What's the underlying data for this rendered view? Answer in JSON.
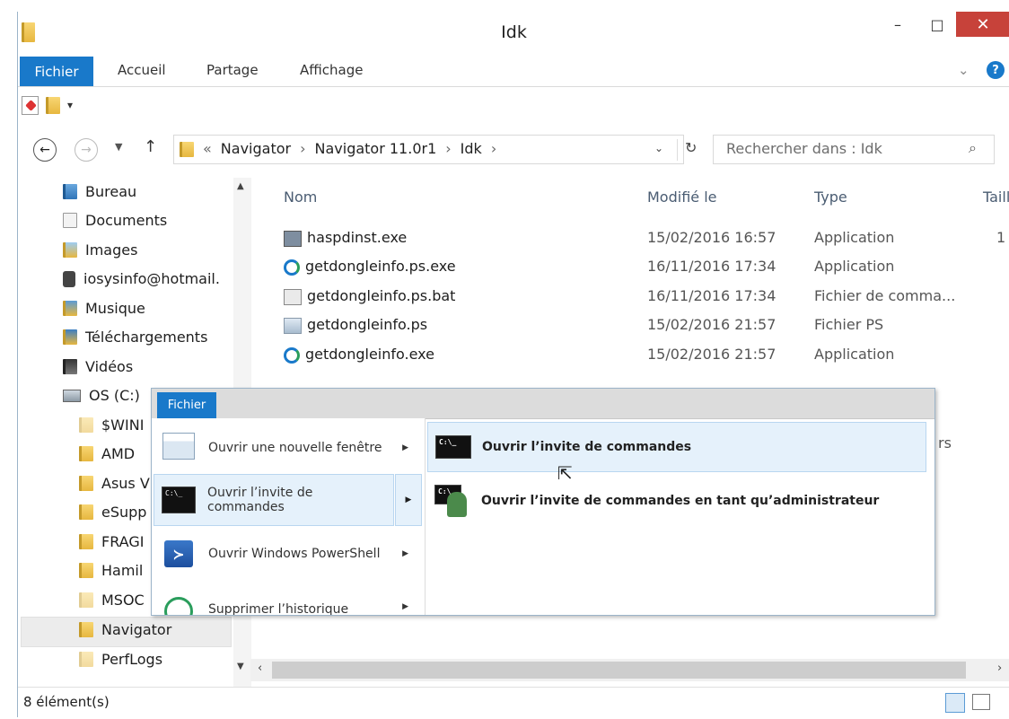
{
  "window": {
    "title": "Idk",
    "close_glyph": "✕",
    "minimize_glyph": "–",
    "maximize_glyph": "□"
  },
  "ribbon": {
    "tabs": [
      "Fichier",
      "Accueil",
      "Partage",
      "Affichage"
    ],
    "help_glyph": "?",
    "collapse_glyph": "⌄"
  },
  "address": {
    "prefix": "«",
    "crumbs": [
      "Navigator",
      "Navigator 11.0r1",
      "Idk"
    ],
    "separator": "›",
    "search_placeholder": "Rechercher dans : Idk"
  },
  "nav_pane": {
    "items": [
      {
        "label": "Bureau"
      },
      {
        "label": "Documents"
      },
      {
        "label": "Images"
      },
      {
        "label": "iosysinfo@hotmail."
      },
      {
        "label": "Musique"
      },
      {
        "label": "Téléchargements"
      },
      {
        "label": "Vidéos"
      },
      {
        "label": "OS (C:)"
      },
      {
        "label": "$WINI"
      },
      {
        "label": "AMD"
      },
      {
        "label": "Asus V"
      },
      {
        "label": "eSupp"
      },
      {
        "label": "FRAGI"
      },
      {
        "label": "Hamil"
      },
      {
        "label": "MSOC"
      },
      {
        "label": "Navigator"
      },
      {
        "label": "PerfLogs"
      }
    ]
  },
  "columns": {
    "name": "Nom",
    "modified": "Modifié le",
    "type": "Type",
    "size": "Taill"
  },
  "files": [
    {
      "name": "haspdinst.exe",
      "modified": "15/02/2016 16:57",
      "type": "Application",
      "size": "1"
    },
    {
      "name": "getdongleinfo.ps.exe",
      "modified": "16/11/2016 17:34",
      "type": "Application",
      "size": ""
    },
    {
      "name": "getdongleinfo.ps.bat",
      "modified": "16/11/2016 17:34",
      "type": "Fichier de comma...",
      "size": ""
    },
    {
      "name": "getdongleinfo.ps",
      "modified": "15/02/2016 21:57",
      "type": "Fichier PS",
      "size": ""
    },
    {
      "name": "getdongleinfo.exe",
      "modified": "15/02/2016 21:57",
      "type": "Application",
      "size": ""
    }
  ],
  "partial_type_fragment": "rs",
  "status": {
    "count": "8 élément(s)"
  },
  "file_menu": {
    "tab": "Fichier",
    "items": [
      {
        "label": "Ouvrir une nouvelle fenêtre"
      },
      {
        "label": "Ouvrir l’invite de commandes"
      },
      {
        "label": "Ouvrir Windows PowerShell"
      },
      {
        "label": "Supprimer l’historique"
      }
    ],
    "submenu": [
      {
        "label": "Ouvrir l’invite de commandes"
      },
      {
        "label": "Ouvrir l’invite de commandes en tant qu’administrateur"
      }
    ],
    "cmd_icon_text": "C:\\_"
  }
}
